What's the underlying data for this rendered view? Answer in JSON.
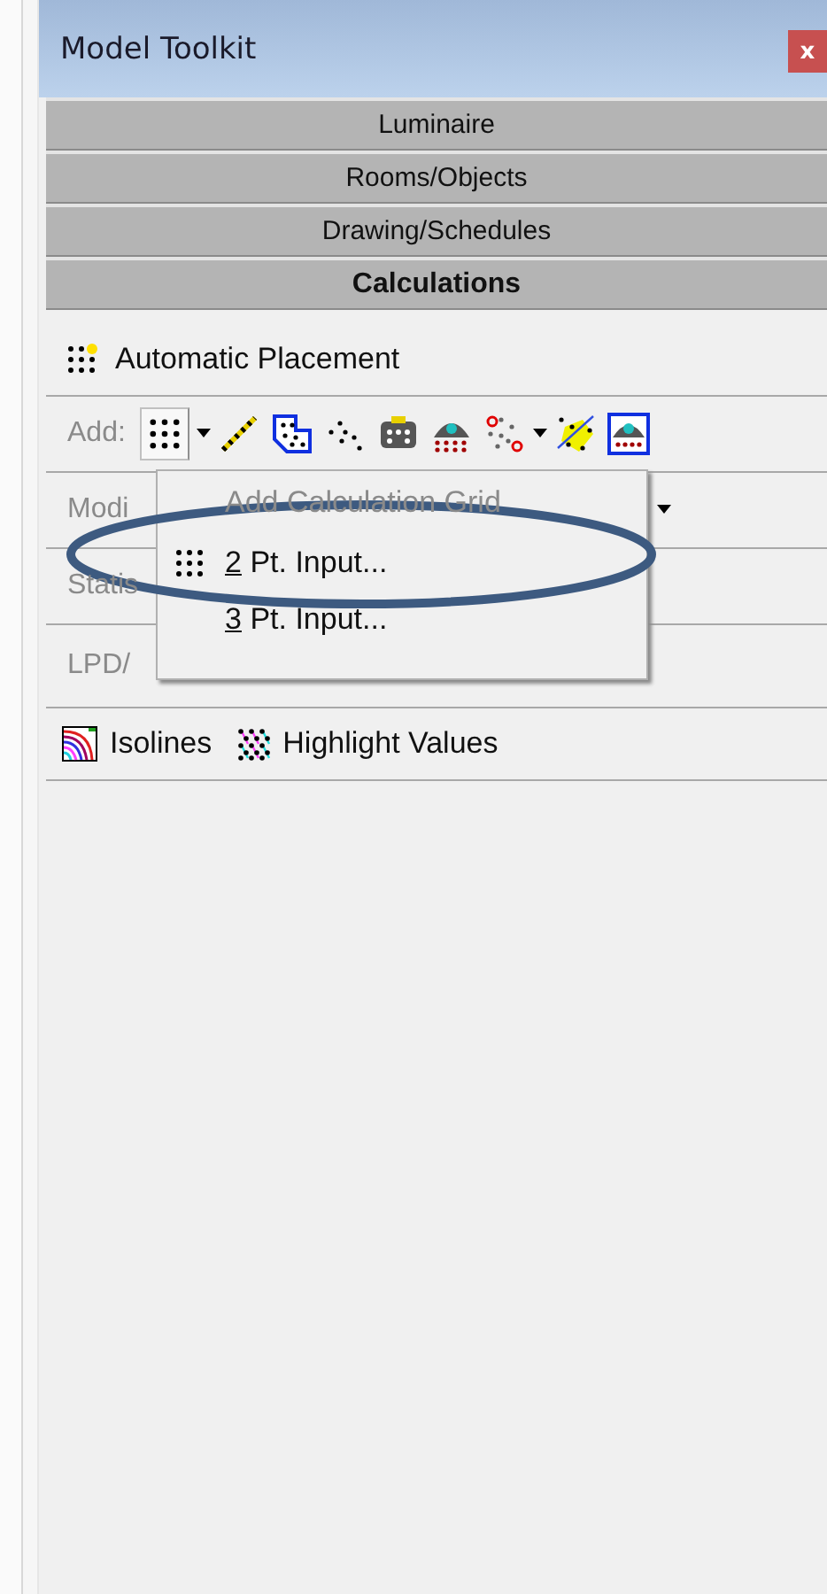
{
  "window": {
    "title": "Model Toolkit",
    "close": "x"
  },
  "tabs": [
    {
      "label": "Luminaire",
      "selected": false
    },
    {
      "label": "Rooms/Objects",
      "selected": false
    },
    {
      "label": "Drawing/Schedules",
      "selected": false
    },
    {
      "label": "Calculations",
      "selected": true
    }
  ],
  "automatic_placement": {
    "label": "Automatic Placement"
  },
  "rows": [
    {
      "label": "Add:",
      "disabled": true
    },
    {
      "label": "Modi",
      "disabled": true
    },
    {
      "label": "Statis",
      "disabled": true
    },
    {
      "label": "LPD/",
      "disabled": true
    }
  ],
  "menu": {
    "title": "Add Calculation Grid",
    "items": [
      {
        "label": "2 Pt. Input...",
        "icon": true
      },
      {
        "label": "3 Pt. Input...",
        "icon": false
      }
    ]
  },
  "bottom_tools": [
    {
      "label": "Isolines",
      "kind": "isolines"
    },
    {
      "label": "Highlight Values",
      "kind": "highlight"
    }
  ]
}
